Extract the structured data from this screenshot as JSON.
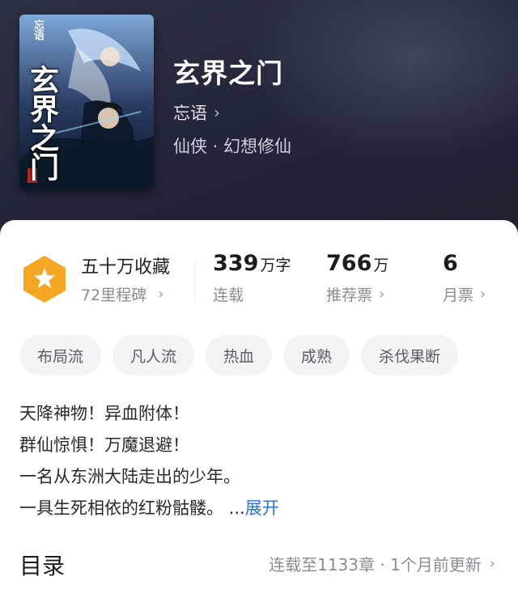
{
  "book": {
    "cover_small_title": "忘语",
    "cover_big_title": "玄界之门",
    "title": "玄界之门",
    "author": "忘语",
    "genre": "仙侠 · 幻想修仙"
  },
  "stats": {
    "collection_title": "五十万收藏",
    "milestone": "72里程碑",
    "word_count_number": "339",
    "word_count_unit": "万字",
    "status": "连载",
    "recommend_number": "766",
    "recommend_unit": "万",
    "recommend_label": "推荐票",
    "monthly_number": "6",
    "monthly_label": "月票"
  },
  "tags": [
    "布局流",
    "凡人流",
    "热血",
    "成熟",
    "杀伐果断"
  ],
  "description": {
    "lines": [
      "天降神物！异血附体！",
      "群仙惊惧！万魔退避！",
      "一名从东洲大陆走出的少年。",
      "一具生死相依的红粉骷髅。"
    ],
    "ellipsis": " ...",
    "expand_label": "展开"
  },
  "toc": {
    "title": "目录",
    "info": "连载至1133章 · 1个月前更新"
  },
  "icons": {
    "chevron": "chevron-right-icon",
    "badge": "star-hexagon-icon"
  },
  "colors": {
    "accent": "#2e6fe0",
    "badge": "#f5a623"
  }
}
